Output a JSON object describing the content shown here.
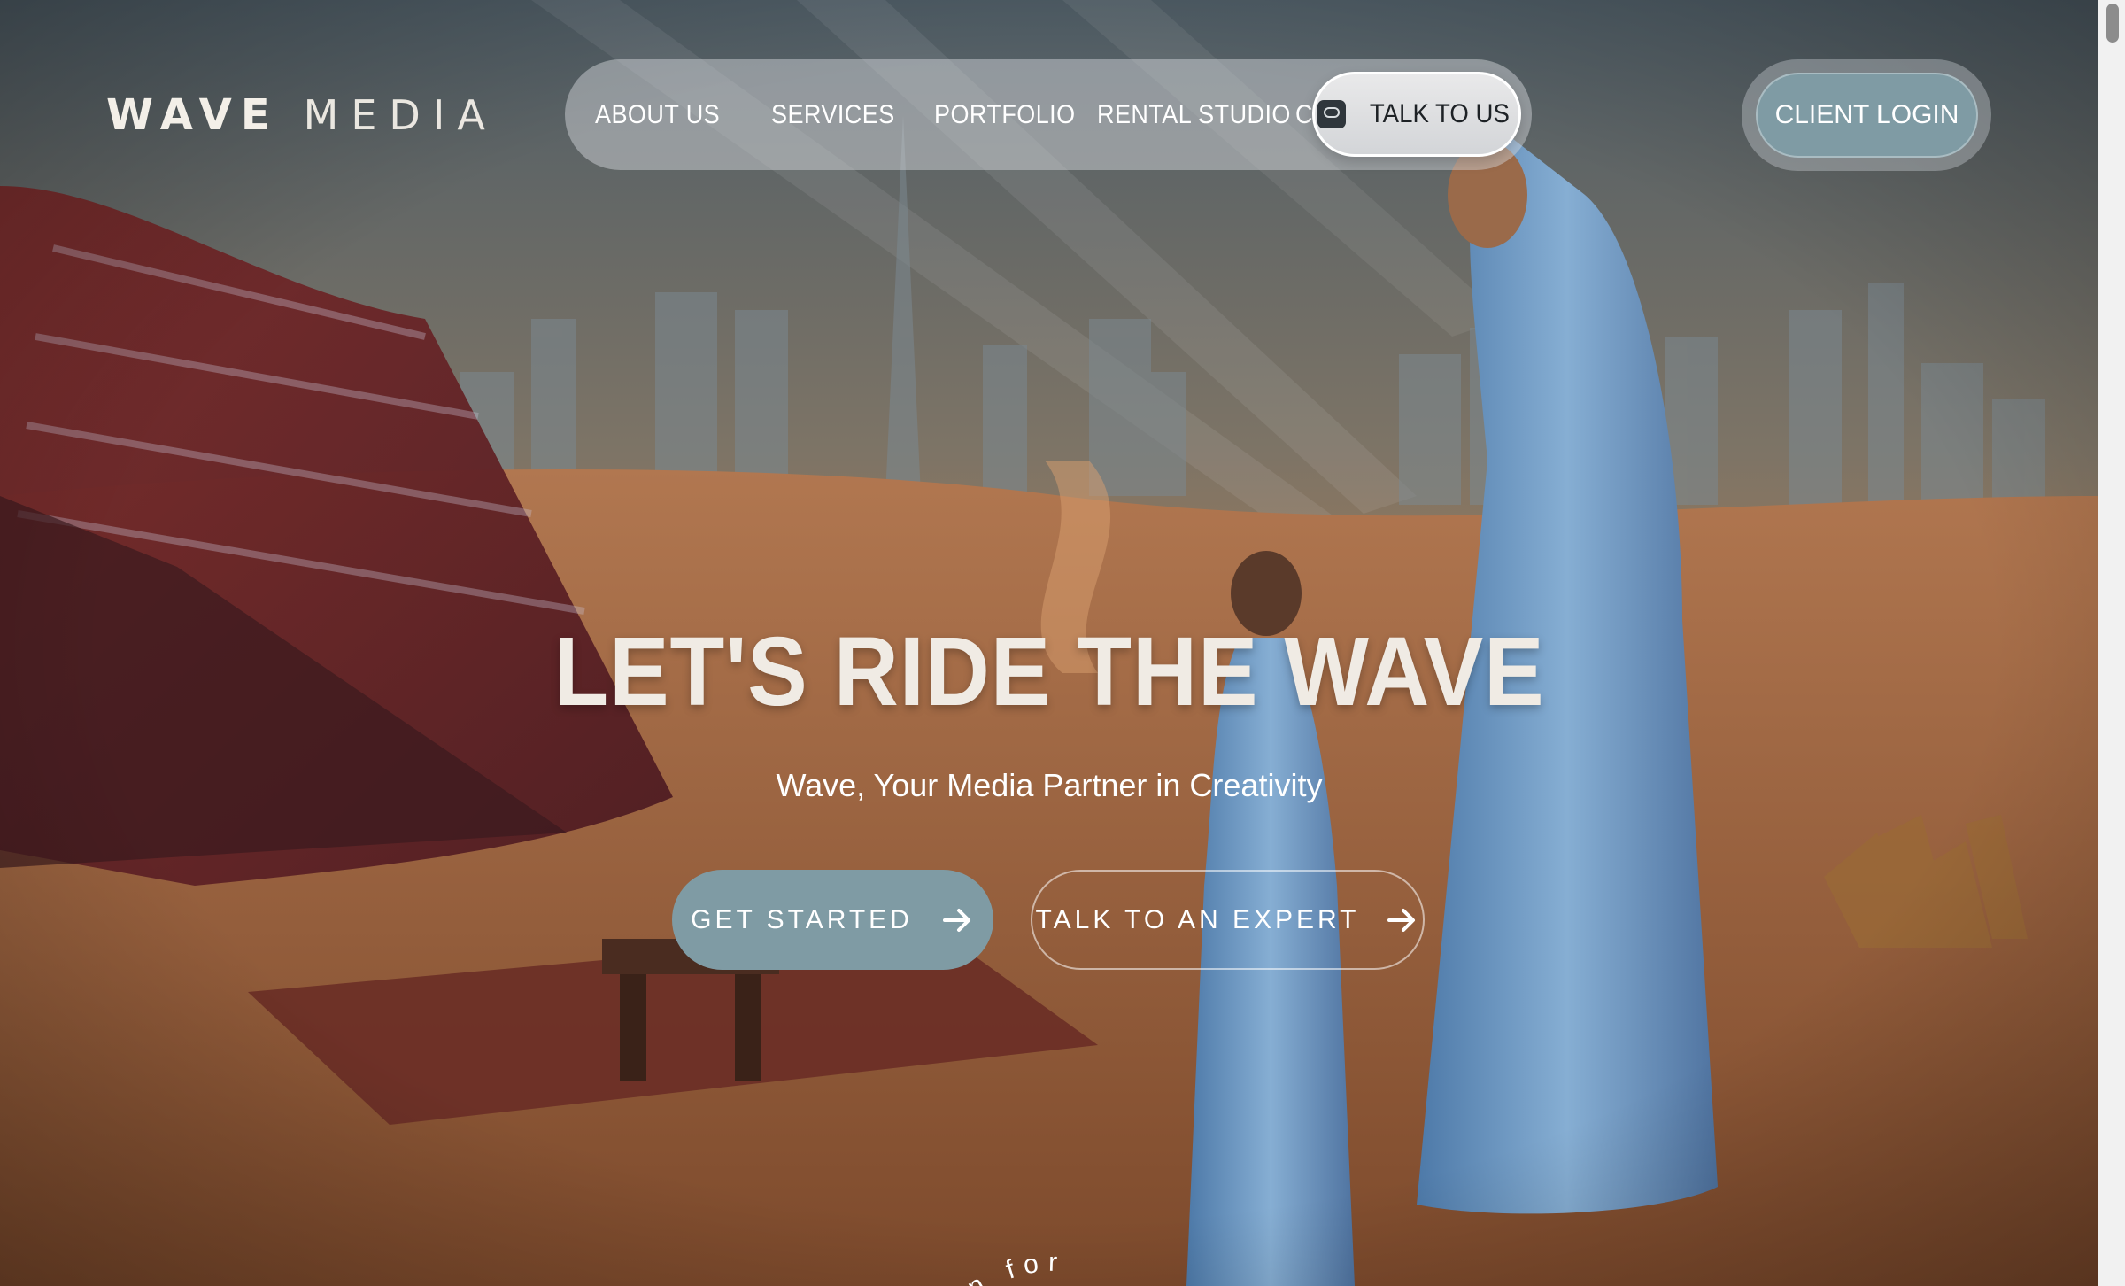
{
  "brand": {
    "logo_word1": "WAVE",
    "logo_word2": "MEDIA"
  },
  "nav": {
    "items": [
      {
        "label": "ABOUT US"
      },
      {
        "label": "SERVICES"
      },
      {
        "label": "PORTFOLIO"
      },
      {
        "label": "RENTAL STUDIO"
      },
      {
        "label": "CAREERS"
      }
    ],
    "talk_button": {
      "label": "TALK TO US",
      "icon": "chat-icon"
    }
  },
  "login_button": {
    "label": "CLIENT LOGIN"
  },
  "hero": {
    "title": "LET'S RIDE THE WAVE",
    "subtitle": "Wave, Your Media Partner in Creativity",
    "primary_cta": {
      "label": "GET STARTED",
      "icon": "arrow-right-icon"
    },
    "secondary_cta": {
      "label": "TALK TO AN EXPERT",
      "icon": "arrow-right-icon"
    },
    "curved_text": "n for"
  },
  "colors": {
    "accent": "#7f9ba4",
    "nav_pill": "#d8dadd",
    "text": "#ffffff",
    "sand": "#b5784a",
    "sky": "#5f6d76"
  }
}
